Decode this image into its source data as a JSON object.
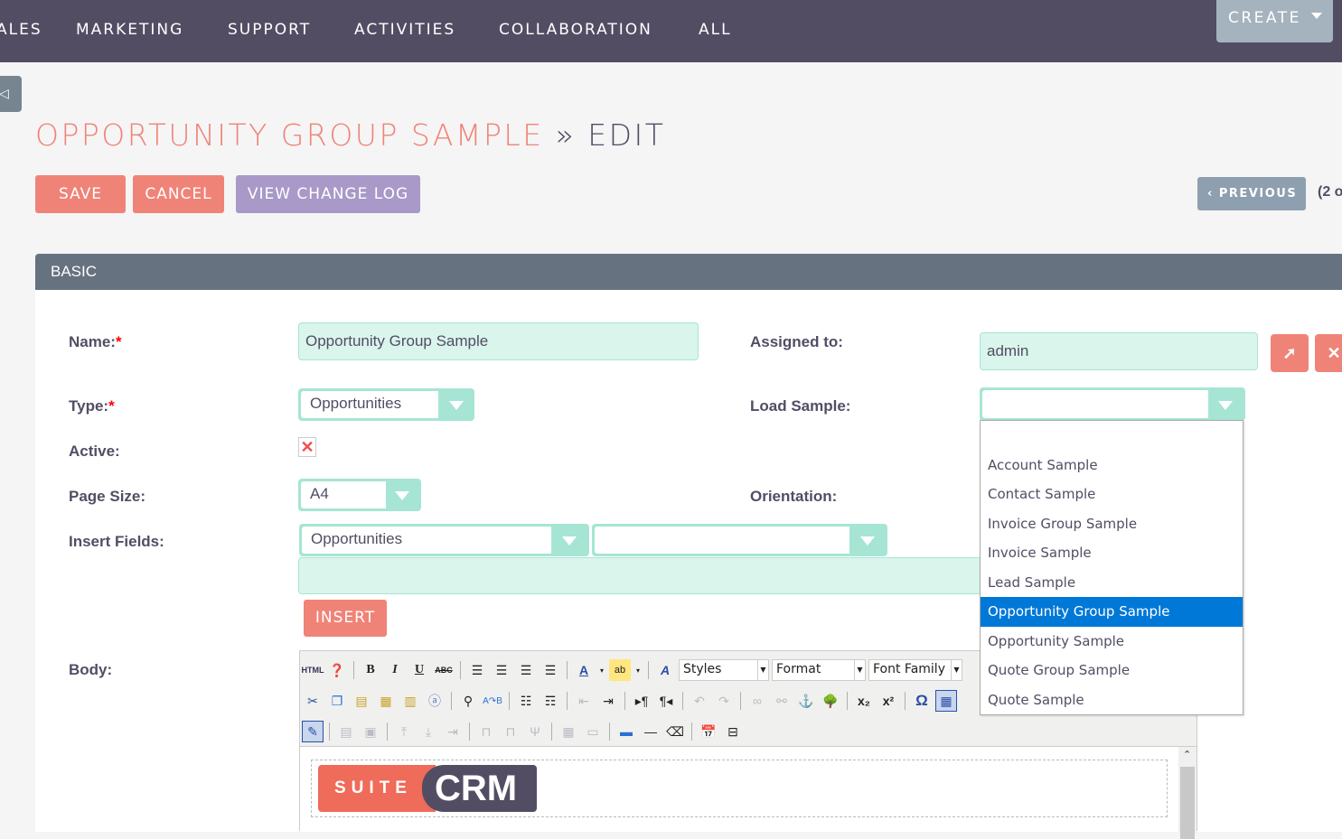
{
  "topnav": {
    "items": [
      "ALES",
      "MARKETING",
      "SUPPORT",
      "ACTIVITIES",
      "COLLABORATION",
      "ALL"
    ],
    "create_label": "CREATE"
  },
  "page": {
    "module": "OPPORTUNITY GROUP SAMPLE",
    "separator": "»",
    "action": "EDIT"
  },
  "actions": {
    "save": "SAVE",
    "cancel": "CANCEL",
    "view_change_log": "VIEW CHANGE LOG",
    "previous": "PREVIOUS",
    "pagination": "(2 o"
  },
  "panel": {
    "title": "BASIC"
  },
  "form": {
    "name_label": "Name:",
    "name_value": "Opportunity Group Sample",
    "type_label": "Type:",
    "type_value": "Opportunities",
    "active_label": "Active:",
    "active_mark": "✕",
    "page_size_label": "Page Size:",
    "page_size_value": "A4",
    "insert_fields_label": "Insert Fields:",
    "insert_module_value": "Opportunities",
    "insert_field_value": "",
    "insert_button": "INSERT",
    "body_label": "Body:",
    "assigned_label": "Assigned to:",
    "assigned_value": "admin",
    "load_sample_label": "Load Sample:",
    "load_sample_value": "",
    "orientation_label": "Orientation:",
    "required_mark": "*"
  },
  "load_sample_options": [
    "",
    "Account Sample",
    "Contact Sample",
    "Invoice Group Sample",
    "Invoice Sample",
    "Lead Sample",
    "Opportunity Group Sample",
    "Opportunity Sample",
    "Quote Group Sample",
    "Quote Sample"
  ],
  "load_sample_highlighted": "Opportunity Group Sample",
  "editor": {
    "styles_label": "Styles",
    "format_label": "Format",
    "font_family_label": "Font Family",
    "logo_left": "SUITE",
    "logo_right": "CRM"
  },
  "colors": {
    "nav_bg": "#534d64",
    "accent_red": "#f08377",
    "accent_purple": "#a899c8",
    "input_bg": "#d9f5ec",
    "panel_header": "#667280",
    "highlight": "#0078d7"
  }
}
